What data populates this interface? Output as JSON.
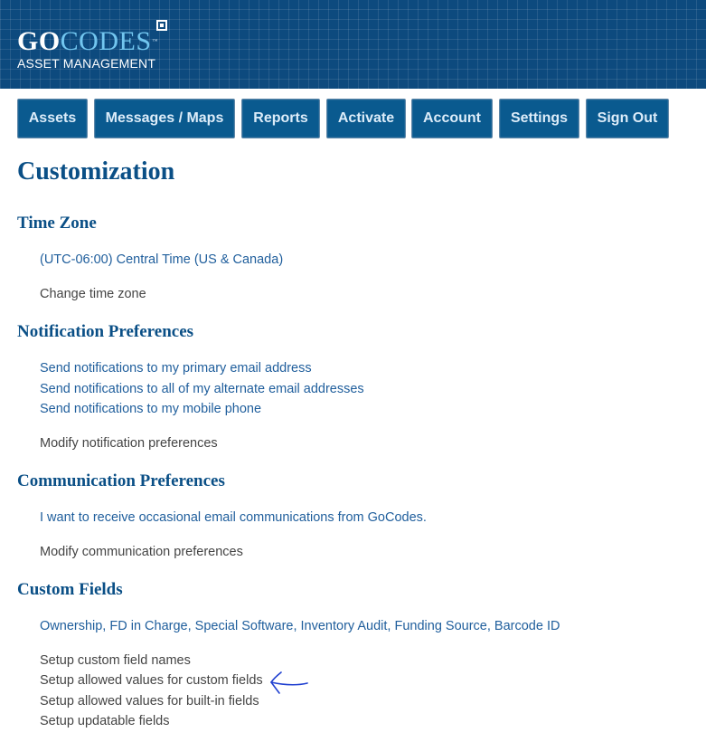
{
  "brand": {
    "name_go": "GO",
    "name_codes": "CODES",
    "trademark": "™",
    "subtitle": "ASSET MANAGEMENT"
  },
  "nav": {
    "items": [
      {
        "label": "Assets"
      },
      {
        "label": "Messages / Maps"
      },
      {
        "label": "Reports"
      },
      {
        "label": "Activate"
      },
      {
        "label": "Account"
      },
      {
        "label": "Settings"
      },
      {
        "label": "Sign Out"
      }
    ]
  },
  "page": {
    "title": "Customization"
  },
  "time_zone": {
    "heading": "Time Zone",
    "value": "(UTC-06:00) Central Time (US & Canada)",
    "action": "Change time zone"
  },
  "notifications": {
    "heading": "Notification Preferences",
    "items": [
      "Send notifications to my primary email address",
      "Send notifications to all of my alternate email addresses",
      "Send notifications to my mobile phone"
    ],
    "action": "Modify notification preferences"
  },
  "communication": {
    "heading": "Communication Preferences",
    "value": "I want to receive occasional email communications from GoCodes.",
    "action": "Modify communication preferences"
  },
  "custom_fields": {
    "heading": "Custom Fields",
    "value": "Ownership, FD in Charge, Special Software, Inventory Audit, Funding Source, Barcode ID",
    "actions": [
      "Setup custom field names",
      "Setup allowed values for custom fields",
      "Setup allowed values for built-in fields",
      "Setup updatable fields"
    ]
  },
  "colors": {
    "header_bg": "#0d4a7e",
    "nav_bg": "#0a5a8f",
    "heading": "#0a4f86",
    "link_text": "#1f5e9c",
    "annotation": "#1f3fd0"
  }
}
